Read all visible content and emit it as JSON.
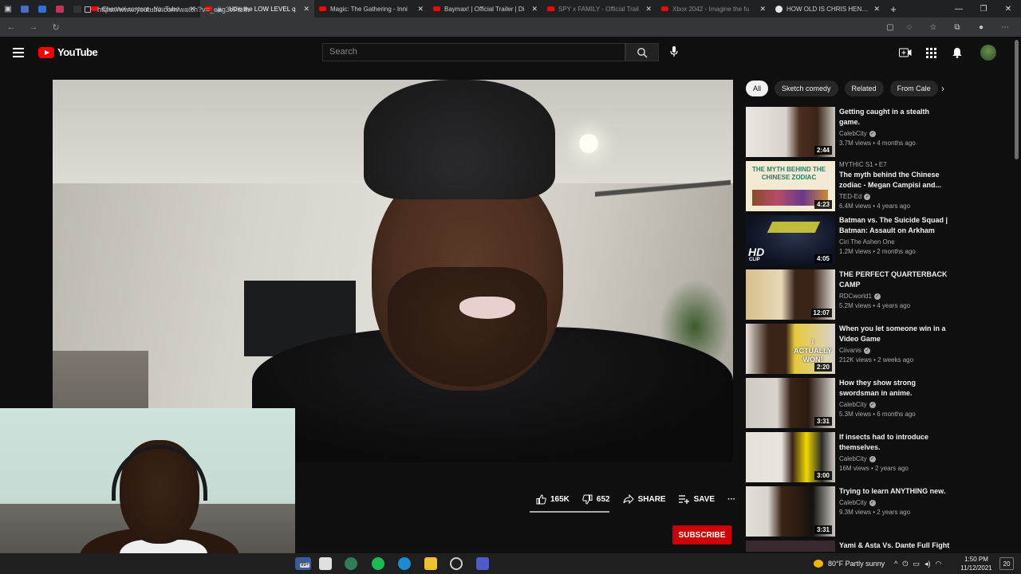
{
  "browser": {
    "tabs": [
      {
        "title": "Channel content - YouTube",
        "active": false
      },
      {
        "title": "How the LOW LEVEL q",
        "active": true
      },
      {
        "title": "Magic: The Gathering - Inni",
        "active": false
      },
      {
        "title": "Baymax! | Official Trailer | Di",
        "active": false
      },
      {
        "title": "SPY x FAMILY - Official Trail",
        "active": false
      },
      {
        "title": "Xbox 2042 - Imagine the fu",
        "active": false
      },
      {
        "title": "HOW OLD IS CHRIS HENSW",
        "active": false
      }
    ],
    "url": "https://www.youtube.com/watch?v=_eag3vFiblw"
  },
  "youtube": {
    "logo_text": "YouTube",
    "search_placeholder": "Search"
  },
  "actions": {
    "likes": "165K",
    "dislikes": "652",
    "share": "SHARE",
    "save": "SAVE",
    "more": "···",
    "subscribe": "SUBSCRIBE"
  },
  "chips": [
    "All",
    "Sketch comedy",
    "Related",
    "From Cale"
  ],
  "recommended": [
    {
      "title": "Getting caught in a stealth game.",
      "channel": "CalebCity",
      "verified": true,
      "meta": "3.7M views • 4 months ago",
      "duration": "2:44",
      "tag": ""
    },
    {
      "title": "The myth behind the Chinese zodiac - Megan Campisi and...",
      "channel": "TED-Ed",
      "verified": true,
      "meta": "6.4M views • 4 years ago",
      "duration": "4:23",
      "tag": "MYTHIC  S1 • E7"
    },
    {
      "title": "Batman vs. The Suicide Squad | Batman: Assault on Arkham",
      "channel": "Ciri The Ashen One",
      "verified": false,
      "meta": "1.2M views • 2 months ago",
      "duration": "4:05",
      "tag": ""
    },
    {
      "title": "THE PERFECT QUARTERBACK CAMP",
      "channel": "RDCworld1",
      "verified": true,
      "meta": "5.2M views • 4 years ago",
      "duration": "12:07",
      "tag": ""
    },
    {
      "title": "When you let someone win in a Video Game",
      "channel": "Ciivanis",
      "verified": true,
      "meta": "212K views • 2 weeks ago",
      "duration": "2:20",
      "tag": ""
    },
    {
      "title": "How they show strong swordsman in anime.",
      "channel": "CalebCity",
      "verified": true,
      "meta": "5.3M views • 6 months ago",
      "duration": "3:31",
      "tag": ""
    },
    {
      "title": "If insects had to introduce themselves.",
      "channel": "CalebCity",
      "verified": true,
      "meta": "16M views • 2 years ago",
      "duration": "3:00",
      "tag": ""
    },
    {
      "title": "Trying to learn ANYTHING new.",
      "channel": "CalebCity",
      "verified": true,
      "meta": "9.3M views • 2 years ago",
      "duration": "3:31",
      "tag": ""
    },
    {
      "title": "Yami & Asta Vs. Dante Full Fight",
      "channel": "",
      "verified": false,
      "meta": "",
      "duration": "",
      "tag": ""
    }
  ],
  "thumb_texts": {
    "zodiac": "THE MYTH BEHIND THE CHINESE ZODIAC",
    "hd": "HD",
    "clip": "CLIP",
    "won": "I ACTUALLY WON!"
  },
  "taskbar": {
    "badge": "99+",
    "weather": "80°F  Partly sunny",
    "time": "1:50 PM",
    "date": "11/12/2021",
    "notif": "20"
  },
  "colors": {
    "accent": "#ff0000",
    "subscribe": "#cc0000",
    "background": "#0f0f0f"
  }
}
